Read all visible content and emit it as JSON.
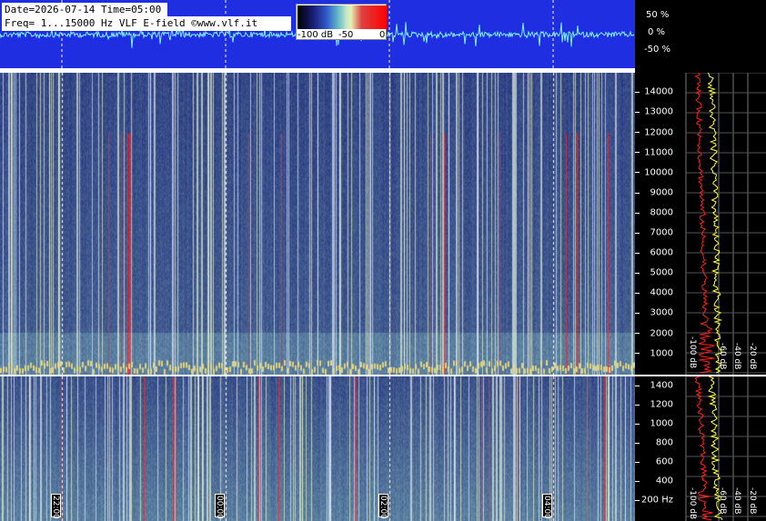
{
  "header": {
    "date_time": "Date=2026-07-14 Time=05:00",
    "freq_line": "Freq= 1...15000 Hz   VLF E-field ©www.vlf.it"
  },
  "colorbar": {
    "labels": [
      "-100 dB",
      "-50",
      "0"
    ]
  },
  "waveform": {
    "percent_labels": [
      "50 %",
      "0 %",
      "-50 %"
    ]
  },
  "upper_axis": {
    "labels": [
      "14000",
      "13000",
      "12000",
      "11000",
      "10000",
      "9000",
      "8000",
      "7000",
      "6000",
      "5000",
      "4000",
      "3000",
      "2000",
      "1000"
    ]
  },
  "lower_axis": {
    "labels": [
      "1400",
      "1200",
      "1000",
      "800",
      "600",
      "400",
      "200 Hz"
    ]
  },
  "profile_db_labels": [
    "-100 dB",
    "-60 dB",
    "-40 dB",
    "-20 dB"
  ],
  "time_markers": [
    "22:00",
    "00:00",
    "02:00",
    "04:00"
  ],
  "colors": {
    "wave_bg": "#1f2ee0",
    "spectrum_dark": "#17206a",
    "spectrum_mid": "#3355c0",
    "spectrum_green": "#8ed7a8",
    "accent_red": "#ff2020",
    "profile_yellow": "#ffff40",
    "profile_red": "#ff2020"
  }
}
